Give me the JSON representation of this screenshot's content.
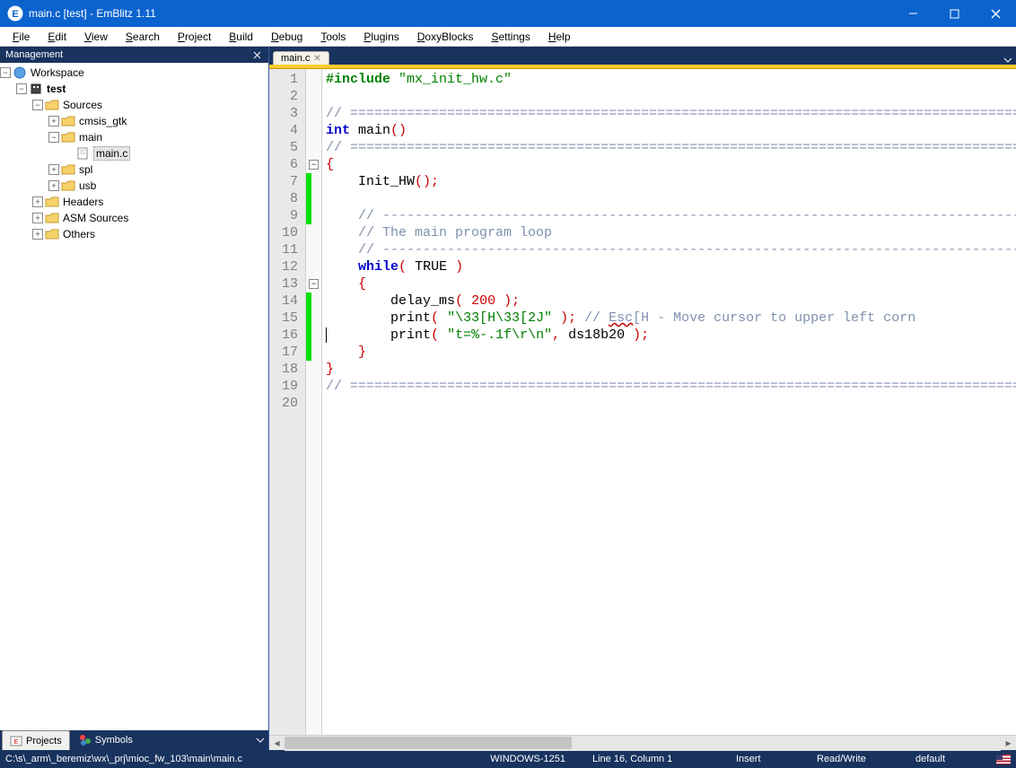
{
  "window": {
    "title": "main.c [test] - EmBlitz 1.11"
  },
  "menu": [
    "File",
    "Edit",
    "View",
    "Search",
    "Project",
    "Build",
    "Debug",
    "Tools",
    "Plugins",
    "DoxyBlocks",
    "Settings",
    "Help"
  ],
  "management": {
    "title": "Management",
    "tabs": [
      {
        "label": "Projects",
        "active": true
      },
      {
        "label": "Symbols",
        "active": false
      }
    ],
    "tree": {
      "workspace": "Workspace",
      "project": "test",
      "folders": {
        "sources": "Sources",
        "cmsis_gtk": "cmsis_gtk",
        "main": "main",
        "main_c": "main.c",
        "spl": "spl",
        "usb": "usb",
        "headers": "Headers",
        "asm_sources": "ASM Sources",
        "others": "Others"
      }
    }
  },
  "editor": {
    "tab": "main.c",
    "lines": [
      {
        "n": 1,
        "tokens": [
          [
            "pp",
            "#include "
          ],
          [
            "str",
            "\"mx_init_hw.c\""
          ]
        ]
      },
      {
        "n": 2,
        "tokens": []
      },
      {
        "n": 3,
        "tokens": [
          [
            "cm",
            "// ====================================================================================="
          ]
        ]
      },
      {
        "n": 4,
        "tokens": [
          [
            "kw",
            "int "
          ],
          [
            "id",
            "main"
          ],
          [
            "pn",
            "()"
          ]
        ]
      },
      {
        "n": 5,
        "tokens": [
          [
            "cm",
            "// ====================================================================================="
          ]
        ]
      },
      {
        "n": 6,
        "fold": "open",
        "tokens": [
          [
            "pn",
            "{"
          ]
        ]
      },
      {
        "n": 7,
        "change": true,
        "tokens": [
          [
            "id",
            "    Init_HW"
          ],
          [
            "pn",
            "();"
          ]
        ]
      },
      {
        "n": 8,
        "change": true,
        "tokens": []
      },
      {
        "n": 9,
        "change": true,
        "tokens": [
          [
            "cm",
            "    // -------------------------------------------------------------------------------"
          ]
        ]
      },
      {
        "n": 10,
        "tokens": [
          [
            "cm",
            "    // The main program loop"
          ]
        ]
      },
      {
        "n": 11,
        "tokens": [
          [
            "cm",
            "    // -------------------------------------------------------------------------------"
          ]
        ]
      },
      {
        "n": 12,
        "tokens": [
          [
            "id",
            "    "
          ],
          [
            "kw",
            "while"
          ],
          [
            "pn",
            "( "
          ],
          [
            "id",
            "TRUE"
          ],
          [
            "pn",
            " )"
          ]
        ]
      },
      {
        "n": 13,
        "fold": "open",
        "tokens": [
          [
            "id",
            "    "
          ],
          [
            "pn",
            "{"
          ]
        ]
      },
      {
        "n": 14,
        "change": true,
        "tokens": [
          [
            "id",
            "        delay_ms"
          ],
          [
            "pn",
            "( "
          ],
          [
            "num",
            "200"
          ],
          [
            "pn",
            " );"
          ]
        ]
      },
      {
        "n": 15,
        "change": true,
        "tokens": [
          [
            "id",
            "        print"
          ],
          [
            "pn",
            "( "
          ],
          [
            "str",
            "\"\\33[H\\33[2J\""
          ],
          [
            "pn",
            " ); "
          ],
          [
            "cm",
            "// "
          ],
          [
            "sq",
            "Esc"
          ],
          [
            "cm",
            "[H - Move cursor to upper left corn"
          ]
        ]
      },
      {
        "n": 16,
        "change": true,
        "tokens": [
          [
            "id",
            "        print"
          ],
          [
            "pn",
            "( "
          ],
          [
            "str",
            "\"t=%-.1f\\r\\n\""
          ],
          [
            "pn",
            ", "
          ],
          [
            "id",
            "ds18b20"
          ],
          [
            "pn",
            " );"
          ]
        ]
      },
      {
        "n": 17,
        "change": true,
        "tokens": [
          [
            "id",
            "    "
          ],
          [
            "pn",
            "}"
          ]
        ]
      },
      {
        "n": 18,
        "tokens": [
          [
            "pn",
            "}"
          ]
        ]
      },
      {
        "n": 19,
        "tokens": [
          [
            "cm",
            "// ====================================================================================="
          ]
        ]
      },
      {
        "n": 20,
        "tokens": []
      }
    ]
  },
  "status": {
    "path": "C:\\s\\_arm\\_beremiz\\wx\\_prj\\mioc_fw_103\\main\\main.c",
    "encoding": "WINDOWS-1251",
    "position": "Line 16, Column 1",
    "mode": "Insert",
    "rw": "Read/Write",
    "profile": "default"
  }
}
